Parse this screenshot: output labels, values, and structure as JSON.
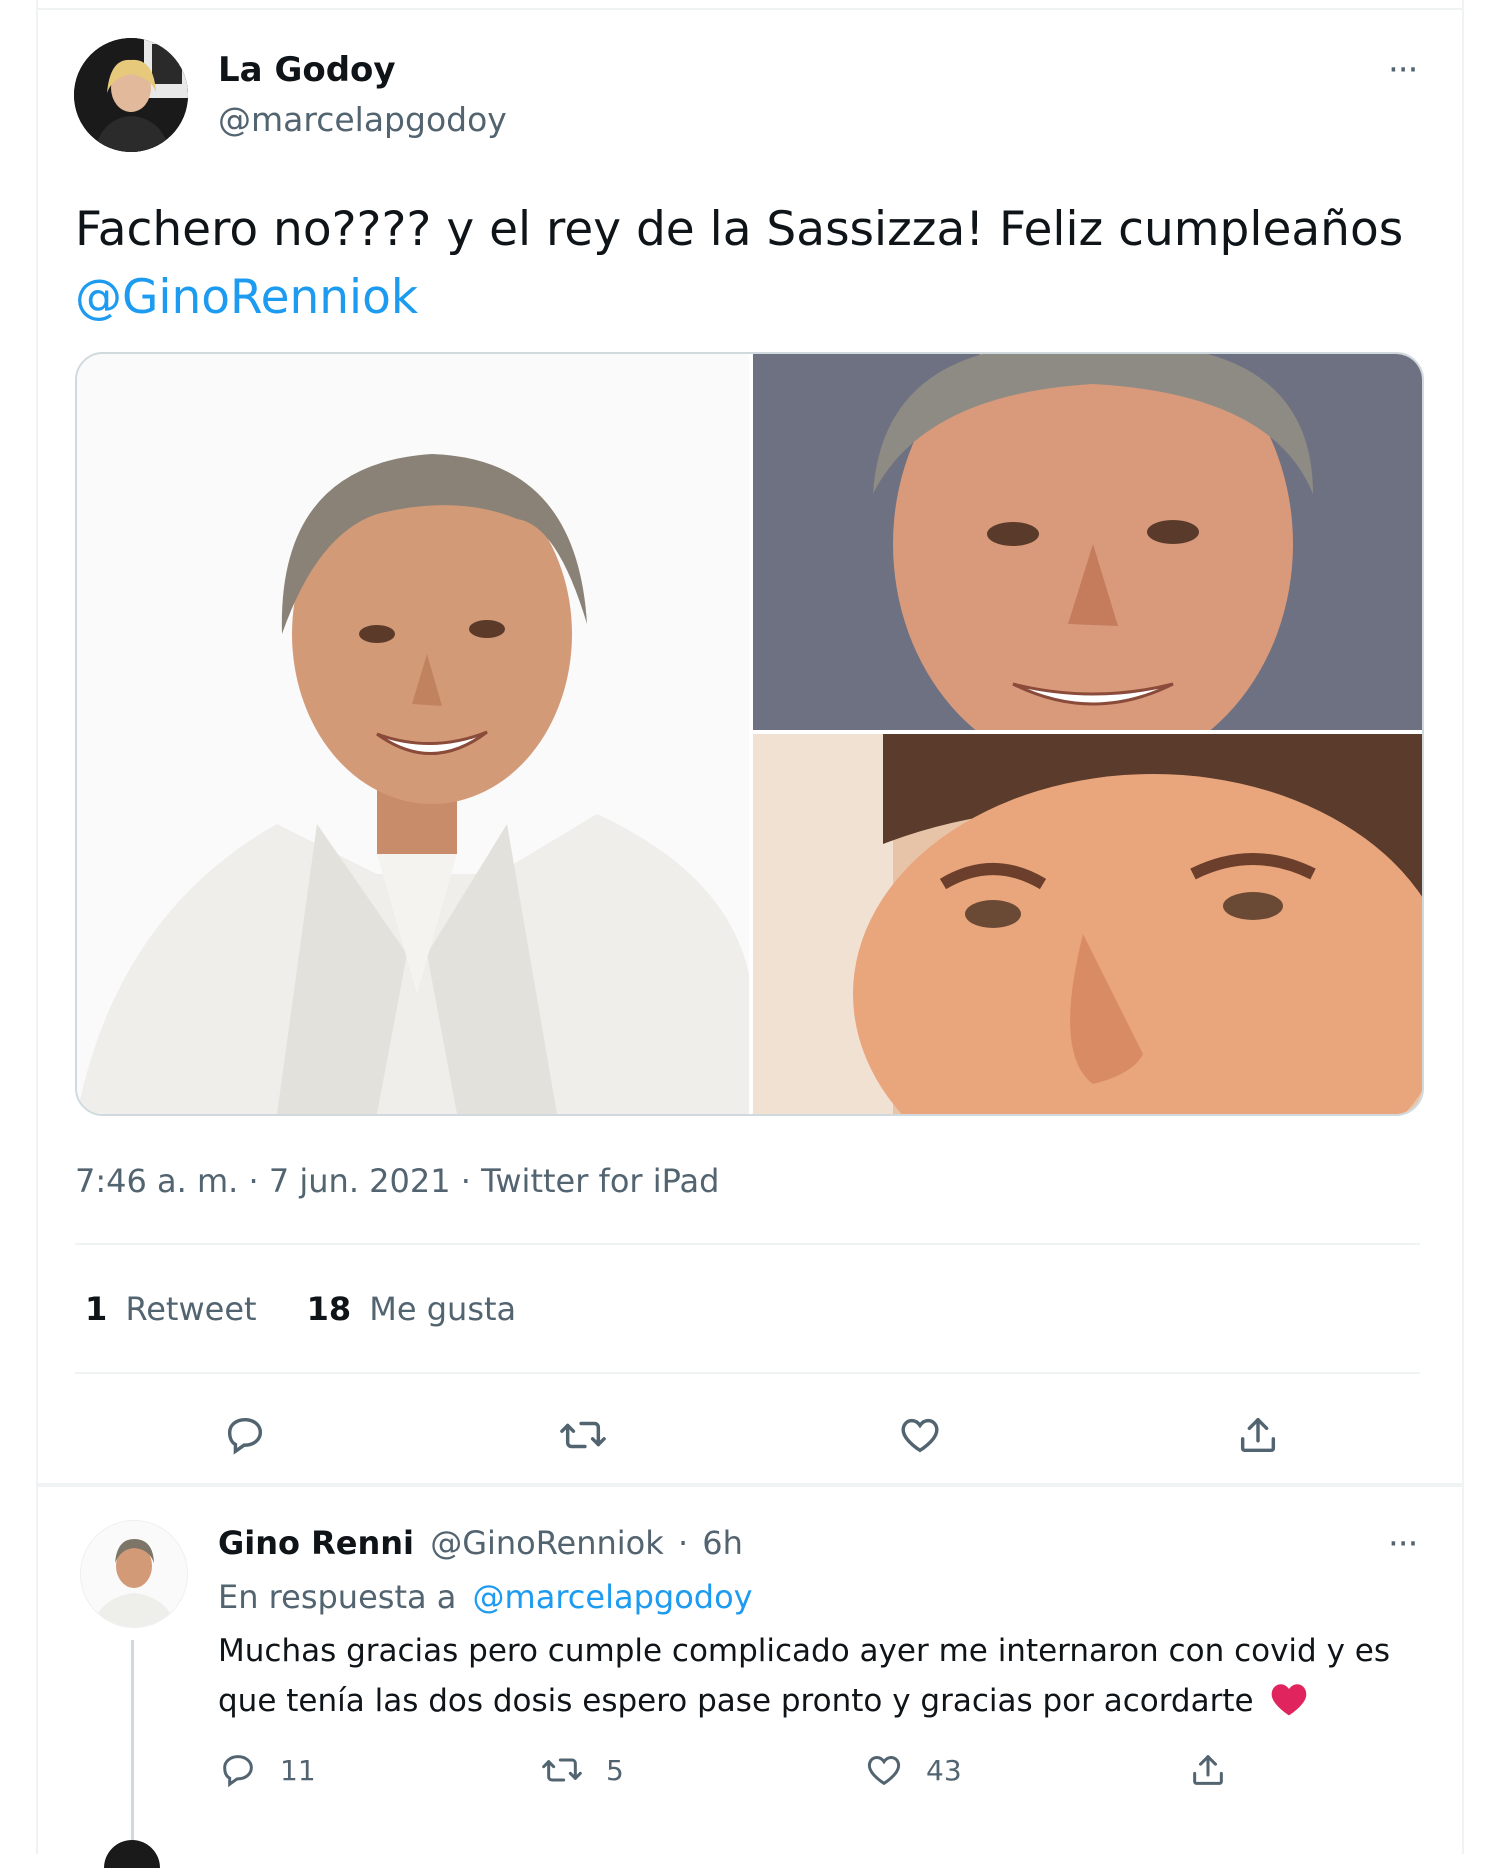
{
  "main_tweet": {
    "author_name": "La Godoy",
    "author_handle": "@marcelapgodoy",
    "more_label": "···",
    "text": "Fachero no???? y el rey de la Sassizza! Feliz cumpleaños",
    "mention": "@GinoRenniok",
    "meta": "7:46 a. m. · 7 jun. 2021 · Twitter for iPad",
    "retweets_count": "1",
    "retweets_label": "Retweet",
    "likes_count": "18",
    "likes_label": "Me gusta",
    "actions": [
      "reply-icon",
      "retweet-icon",
      "like-icon",
      "share-icon"
    ]
  },
  "reply_tweet": {
    "author_name": "Gino Renni",
    "author_handle": "@GinoRenniok",
    "dot": "·",
    "time": "6h",
    "more_label": "···",
    "in_reply_prefix": "En respuesta a",
    "in_reply_handle": "@marcelapgodoy",
    "text_line1": "Muchas gracias pero cumple complicado ayer me internaron con covid y es",
    "text_line2": "que tenía las dos dosis espero pase pronto y gracias por acordarte",
    "heart_emoji": "❤️",
    "reply_count": "11",
    "retweet_count": "5",
    "like_count": "43"
  },
  "colors": {
    "accent": "#1d9bf0",
    "muted": "#536471",
    "text": "#0f1419",
    "divider": "#eff3f4",
    "heart": "#e0245e"
  }
}
